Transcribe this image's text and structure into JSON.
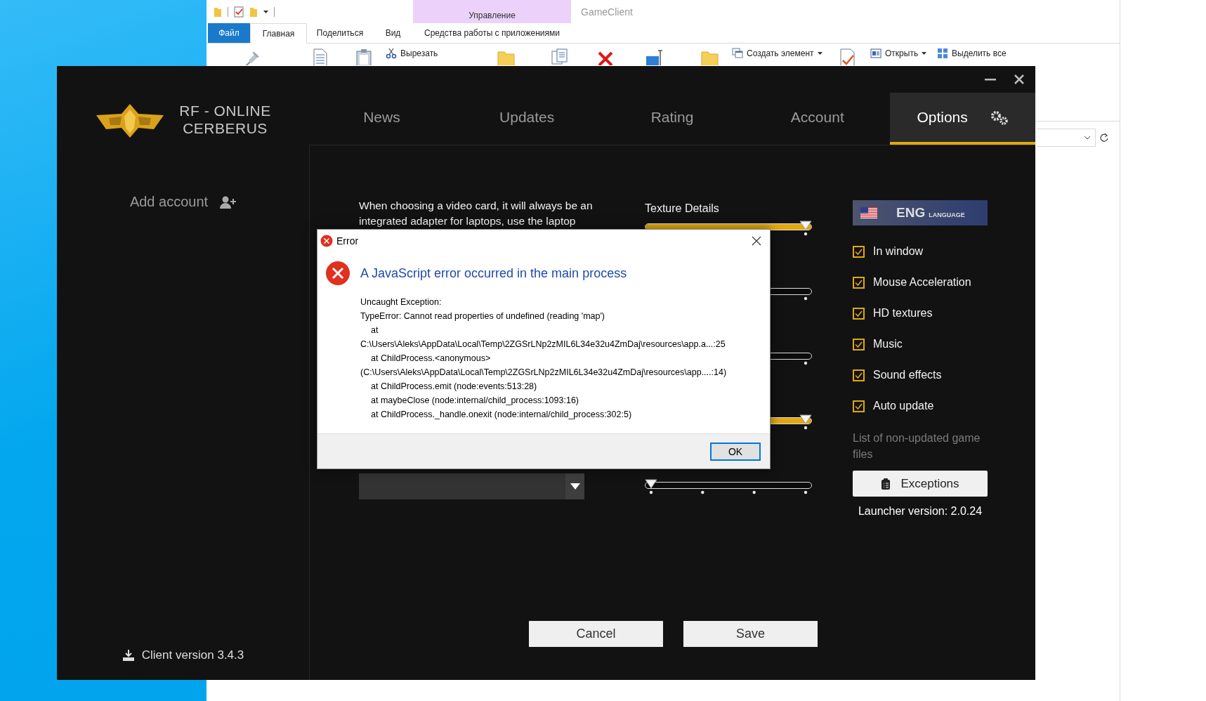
{
  "explorer": {
    "context_group": "Управление",
    "title": "GameClient",
    "tabs": [
      {
        "label": "Файл",
        "kind": "file",
        "selected": false
      },
      {
        "label": "Главная",
        "kind": "tab",
        "selected": true
      },
      {
        "label": "Поделиться",
        "kind": "tab",
        "selected": false
      },
      {
        "label": "Вид",
        "kind": "tab",
        "selected": false
      },
      {
        "label": "Средства работы с приложениями",
        "kind": "context",
        "selected": false
      }
    ],
    "commands": [
      {
        "label": "Вырезать",
        "dropdown": false
      },
      {
        "label": "Создать элемент",
        "dropdown": true
      },
      {
        "label": "Открыть",
        "dropdown": true
      },
      {
        "label": "Выделить все",
        "dropdown": false
      }
    ]
  },
  "launcher": {
    "brand": "RF - ONLINE",
    "subtitle": "CERBERUS",
    "tabs": [
      {
        "label": "News",
        "selected": false
      },
      {
        "label": "Updates",
        "selected": false
      },
      {
        "label": "Rating",
        "selected": false
      },
      {
        "label": "Account",
        "selected": false
      },
      {
        "label": "Options",
        "selected": true
      }
    ],
    "sidebar": {
      "add_account": "Add account",
      "client_version": "Client version 3.4.3"
    },
    "video_card_note": "When choosing a video card, it will always be an integrated adapter for laptops, use the laptop",
    "sliders": [
      {
        "kind": "slider",
        "label": "Texture Details",
        "level": 1
      },
      {
        "kind": "track"
      },
      {
        "kind": "track"
      },
      {
        "kind": "slider",
        "level": 1
      },
      {
        "kind": "slider",
        "level": 0
      }
    ],
    "language": {
      "code": "ENG",
      "label": "LANGUAGE"
    },
    "checkboxes": [
      {
        "label": "In window",
        "checked": true
      },
      {
        "label": "Mouse Acceleration",
        "checked": true
      },
      {
        "label": "HD textures",
        "checked": true
      },
      {
        "label": "Music",
        "checked": true
      },
      {
        "label": "Sound effects",
        "checked": true
      },
      {
        "label": "Auto update",
        "checked": true
      }
    ],
    "exceptions_note": "List of non-updated game files",
    "exceptions_button": "Exceptions",
    "launcher_version": "Launcher version: 2.0.24",
    "buttons": [
      "Cancel",
      "Save"
    ]
  },
  "dialog": {
    "title": "Error",
    "heading": "A JavaScript error occurred in the main process",
    "lines": [
      {
        "text": "Uncaught Exception:",
        "indented": false
      },
      {
        "text": "TypeError: Cannot read properties of undefined (reading 'map')",
        "indented": false
      },
      {
        "text": "at",
        "indented": true
      },
      {
        "text": "C:\\Users\\Aleks\\AppData\\Local\\Temp\\2ZGSrLNp2zMIL6L34e32u4ZmDaj\\resources\\app.a...:25",
        "indented": false
      },
      {
        "text": "at ChildProcess.<anonymous>",
        "indented": true
      },
      {
        "text": "(C:\\Users\\Aleks\\AppData\\Local\\Temp\\2ZGSrLNp2zMIL6L34e32u4ZmDaj\\resources\\app....:14)",
        "indented": false
      },
      {
        "text": "at ChildProcess.emit (node:events:513:28)",
        "indented": true
      },
      {
        "text": "at maybeClose (node:internal/child_process:1093:16)",
        "indented": true
      },
      {
        "text": "at ChildProcess._handle.onexit (node:internal/child_process:302:5)",
        "indented": true
      }
    ],
    "button": "OK"
  }
}
